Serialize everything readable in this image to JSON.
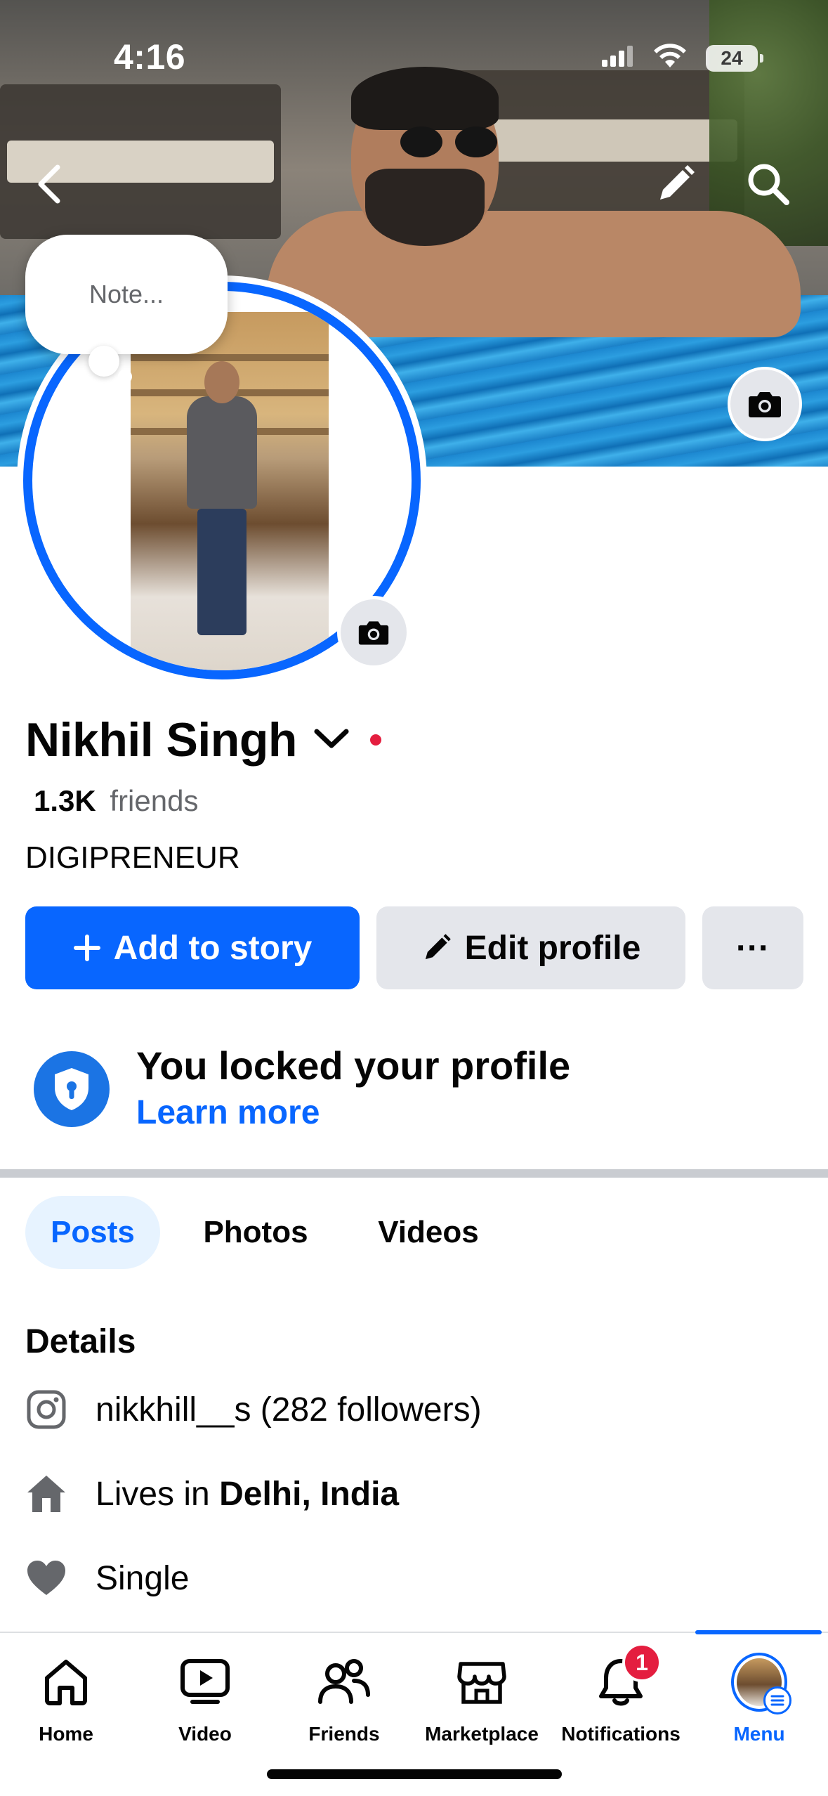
{
  "status_bar": {
    "time": "4:16",
    "battery": "24"
  },
  "profile": {
    "note_placeholder": "Note...",
    "name": "Nikhil Singh",
    "friends_count": "1.3K",
    "friends_label": "friends",
    "bio": "DIGIPRENEUR"
  },
  "actions": {
    "add_to_story": "Add to story",
    "edit_profile": "Edit profile",
    "more": "···"
  },
  "locked_banner": {
    "title": "You locked your profile",
    "link": "Learn more"
  },
  "tabs": [
    {
      "label": "Posts",
      "active": true
    },
    {
      "label": "Photos",
      "active": false
    },
    {
      "label": "Videos",
      "active": false
    }
  ],
  "details": {
    "heading": "Details",
    "instagram": "nikkhill__s (282 followers)",
    "lives_prefix": "Lives in",
    "lives_place": "Delhi, India",
    "relationship": "Single"
  },
  "nav": {
    "items": [
      {
        "label": "Home",
        "icon": "home-icon"
      },
      {
        "label": "Video",
        "icon": "video-icon"
      },
      {
        "label": "Friends",
        "icon": "friends-icon"
      },
      {
        "label": "Marketplace",
        "icon": "marketplace-icon"
      },
      {
        "label": "Notifications",
        "icon": "bell-icon"
      },
      {
        "label": "Menu",
        "icon": "menu-avatar"
      }
    ],
    "notification_count": "1",
    "active": "Menu"
  },
  "colors": {
    "brand_blue": "#0866ff",
    "button_grey": "#e4e6eb",
    "badge_red": "#e41e3f",
    "secondary_text": "#65676b"
  }
}
